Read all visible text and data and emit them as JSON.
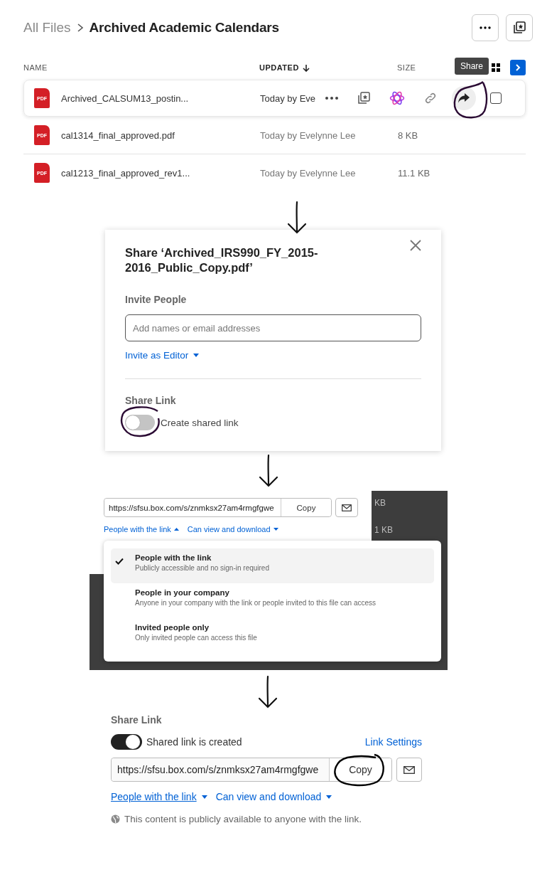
{
  "file_browser": {
    "breadcrumb": [
      {
        "label": "All Files",
        "current": false
      },
      {
        "label": "Archived Academic Calendars",
        "current": true
      }
    ],
    "columns": [
      {
        "label": "NAME",
        "sorted": false
      },
      {
        "label": "UPDATED",
        "sorted": true
      },
      {
        "label": "SIZE",
        "sorted": false
      }
    ],
    "tooltip": "Share",
    "rows": [
      {
        "file_type": "PDF",
        "name": "Archived_CALSUM13_postin...",
        "updated": "Today by Eve",
        "hovered": true
      },
      {
        "file_type": "PDF",
        "name": "cal1314_final_approved.pdf",
        "updated": "Today by Evelynne Lee",
        "size": "8 KB",
        "hovered": false
      },
      {
        "file_type": "PDF",
        "name": "cal1213_final_approved_rev1...",
        "updated": "Today by Evelynne Lee",
        "size": "11.1 KB",
        "hovered": false
      }
    ]
  },
  "share_dialog": {
    "title": "Share ‘Archived_IRS990_FY_2015-2016_Public_Copy.pdf’",
    "invite_label": "Invite People",
    "placeholder": "Add names or email addresses",
    "invite_role": "Invite as Editor",
    "share_link_label": "Share Link",
    "toggle": {
      "label": "Create shared link",
      "on": false
    }
  },
  "link_dropdown": {
    "background_texts": [
      "KB",
      "1 KB"
    ],
    "url": "https://sfsu.box.com/s/znmksx27am4rmgfgwе",
    "copy": "Copy",
    "access": "People with the link",
    "access_open": true,
    "permission": "Can view and download",
    "options": [
      {
        "title": "People with the link",
        "description": "Publicly accessible and no sign-in required",
        "selected": true
      },
      {
        "title": "People in your company",
        "description": "Anyone in your company with the link or people invited to this file can access",
        "selected": false
      },
      {
        "title": "Invited people only",
        "description": "Only invited people can access this file",
        "selected": false
      }
    ]
  },
  "share_link": {
    "label": "Share Link",
    "toggle": {
      "label": "Shared link is created",
      "on": true
    },
    "link_settings": "Link Settings",
    "url": "https://sfsu.box.com/s/znmksx27am4rmgfgwе",
    "copy": "Copy",
    "access": "People with the link",
    "access_open": false,
    "permission": "Can view and download",
    "notice": "This content is publicly available to anyone with the link."
  }
}
